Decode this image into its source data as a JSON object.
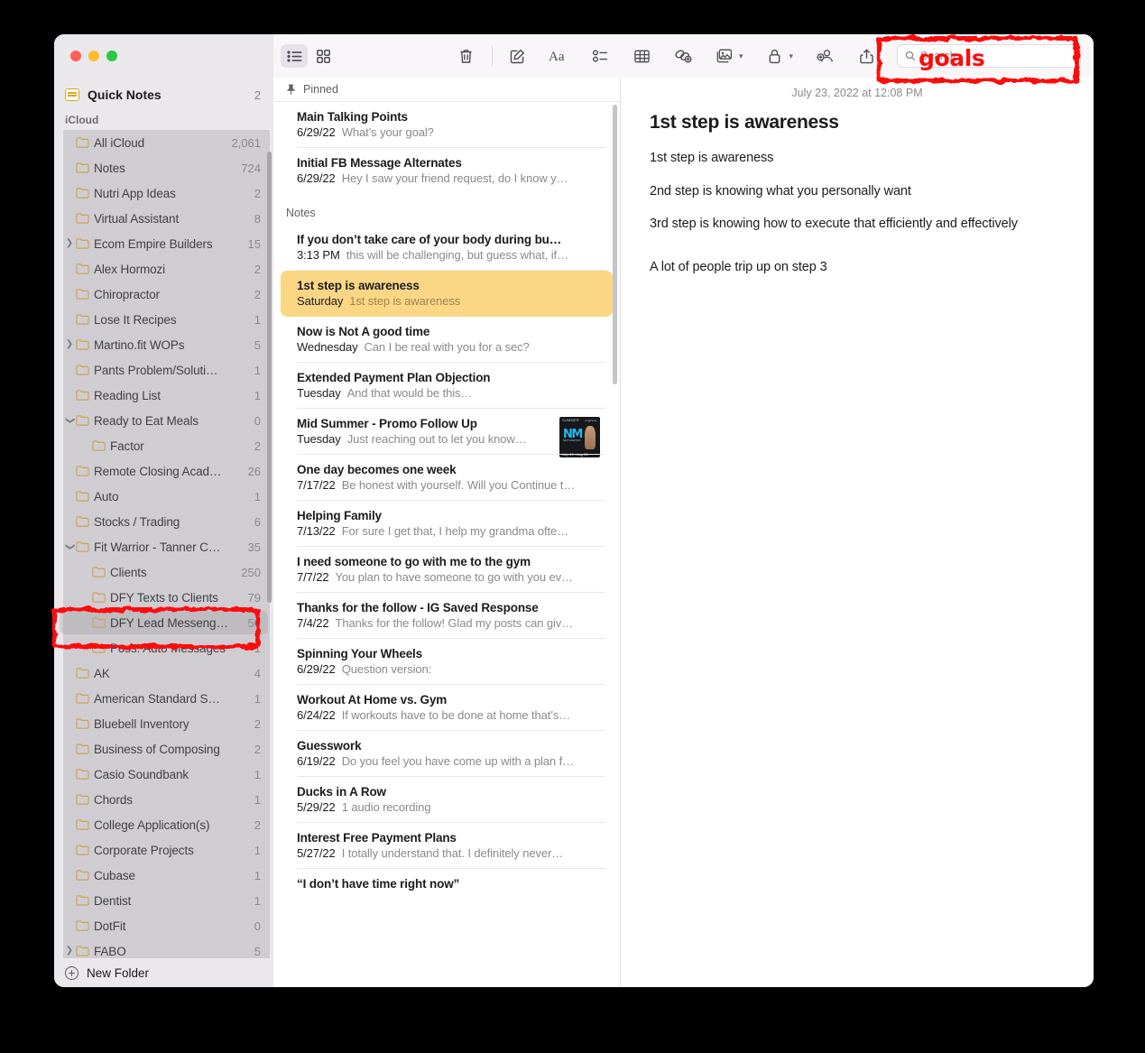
{
  "window": {
    "traffic_lights": [
      "close",
      "minimize",
      "zoom"
    ]
  },
  "sidebar": {
    "quick_notes": {
      "label": "Quick Notes",
      "count": "2",
      "icon": "quick-note-icon"
    },
    "section_icloud": "iCloud",
    "new_folder_label": "New Folder",
    "items": [
      {
        "label": "All iCloud",
        "count": "2,061",
        "indent": 0,
        "disclosure": ""
      },
      {
        "label": "Notes",
        "count": "724",
        "indent": 0,
        "disclosure": ""
      },
      {
        "label": "Nutri App Ideas",
        "count": "2",
        "indent": 0,
        "disclosure": ""
      },
      {
        "label": "Virtual Assistant",
        "count": "8",
        "indent": 0,
        "disclosure": ""
      },
      {
        "label": "Ecom Empire Builders",
        "count": "15",
        "indent": 0,
        "disclosure": "collapsed"
      },
      {
        "label": "Alex Hormozi",
        "count": "2",
        "indent": 0,
        "disclosure": ""
      },
      {
        "label": "Chiropractor",
        "count": "2",
        "indent": 0,
        "disclosure": ""
      },
      {
        "label": "Lose It Recipes",
        "count": "1",
        "indent": 0,
        "disclosure": ""
      },
      {
        "label": "Martino.fit WOPs",
        "count": "5",
        "indent": 0,
        "disclosure": "collapsed"
      },
      {
        "label": "Pants Problem/Soluti…",
        "count": "1",
        "indent": 0,
        "disclosure": ""
      },
      {
        "label": "Reading List",
        "count": "1",
        "indent": 0,
        "disclosure": ""
      },
      {
        "label": "Ready to Eat Meals",
        "count": "0",
        "indent": 0,
        "disclosure": "expanded"
      },
      {
        "label": "Factor",
        "count": "2",
        "indent": 1,
        "disclosure": ""
      },
      {
        "label": "Remote Closing Acad…",
        "count": "26",
        "indent": 0,
        "disclosure": ""
      },
      {
        "label": "Auto",
        "count": "1",
        "indent": 0,
        "disclosure": ""
      },
      {
        "label": "Stocks / Trading",
        "count": "6",
        "indent": 0,
        "disclosure": ""
      },
      {
        "label": "Fit Warrior - Tanner C…",
        "count": "35",
        "indent": 0,
        "disclosure": "expanded"
      },
      {
        "label": "Clients",
        "count": "250",
        "indent": 1,
        "disclosure": ""
      },
      {
        "label": "DFY Texts to Clients",
        "count": "79",
        "indent": 1,
        "disclosure": ""
      },
      {
        "label": "DFY Lead Messeng…",
        "count": "50",
        "indent": 1,
        "disclosure": "",
        "selected": true
      },
      {
        "label": "Poss. Auto Messages",
        "count": "1",
        "indent": 1,
        "disclosure": ""
      },
      {
        "label": "AK",
        "count": "4",
        "indent": 0,
        "disclosure": ""
      },
      {
        "label": "American Standard S…",
        "count": "1",
        "indent": 0,
        "disclosure": ""
      },
      {
        "label": "Bluebell Inventory",
        "count": "2",
        "indent": 0,
        "disclosure": ""
      },
      {
        "label": "Business of Composing",
        "count": "2",
        "indent": 0,
        "disclosure": ""
      },
      {
        "label": "Casio Soundbank",
        "count": "1",
        "indent": 0,
        "disclosure": ""
      },
      {
        "label": "Chords",
        "count": "1",
        "indent": 0,
        "disclosure": ""
      },
      {
        "label": "College Application(s)",
        "count": "2",
        "indent": 0,
        "disclosure": ""
      },
      {
        "label": "Corporate Projects",
        "count": "1",
        "indent": 0,
        "disclosure": ""
      },
      {
        "label": "Cubase",
        "count": "1",
        "indent": 0,
        "disclosure": ""
      },
      {
        "label": "Dentist",
        "count": "1",
        "indent": 0,
        "disclosure": ""
      },
      {
        "label": "DotFit",
        "count": "0",
        "indent": 0,
        "disclosure": ""
      },
      {
        "label": "FABO",
        "count": "5",
        "indent": 0,
        "disclosure": "collapsed"
      }
    ]
  },
  "toolbar": {
    "buttons": [
      {
        "name": "list-view-icon",
        "active": true
      },
      {
        "name": "gallery-view-icon",
        "active": false
      },
      {
        "name": "trash-icon",
        "active": false
      },
      {
        "name": "compose-note-icon",
        "active": false
      },
      {
        "name": "format-text-icon",
        "active": false
      },
      {
        "name": "checklist-icon",
        "active": false
      },
      {
        "name": "table-icon",
        "active": false
      },
      {
        "name": "link-icon",
        "active": false
      },
      {
        "name": "media-icon",
        "active": false
      },
      {
        "name": "lock-icon",
        "active": false
      },
      {
        "name": "add-people-icon",
        "active": false
      },
      {
        "name": "share-icon",
        "active": false
      }
    ],
    "search": {
      "placeholder": "Search",
      "value": ""
    }
  },
  "note_list": {
    "pinned_label": "Pinned",
    "notes_label": "Notes",
    "pinned": [
      {
        "title": "Main Talking Points",
        "date": "6/29/22",
        "preview": "What’s your goal?"
      },
      {
        "title": "Initial FB Message Alternates",
        "date": "6/29/22",
        "preview": "Hey I saw your friend request, do I know y…"
      }
    ],
    "notes": [
      {
        "title": "If you don’t take care of your body during bu…",
        "date": "3:13 PM",
        "preview": "this will be challenging, but guess what, if…"
      },
      {
        "title": "1st step is awareness",
        "date": "Saturday",
        "preview": "1st step is awareness",
        "selected": true
      },
      {
        "title": "Now is Not A good time",
        "date": "Wednesday",
        "preview": "Can I be real with you for a sec?"
      },
      {
        "title": "Extended Payment Plan Objection",
        "date": "Tuesday",
        "preview": "And that would be this…"
      },
      {
        "title": "Mid Summer - Promo Follow Up",
        "date": "Tuesday",
        "preview": "Just reaching out to let you know…",
        "thumbnail": "promo-flyer-thumbnail"
      },
      {
        "title": "One day becomes one week",
        "date": "7/17/22",
        "preview": "Be honest with yourself. Will you Continue t…"
      },
      {
        "title": "Helping Family",
        "date": "7/13/22",
        "preview": "For sure I get that, I help my grandma ofte…"
      },
      {
        "title": "I need someone to go with me to the gym",
        "date": "7/7/22",
        "preview": "You plan to have someone to go with you ev…"
      },
      {
        "title": "Thanks for the follow - IG Saved Response",
        "date": "7/4/22",
        "preview": "Thanks for the follow! Glad my posts can giv…"
      },
      {
        "title": "Spinning Your Wheels",
        "date": "6/29/22",
        "preview": "Question version:"
      },
      {
        "title": "Workout At Home vs. Gym",
        "date": "6/24/22",
        "preview": "If workouts have to be done at home that’s…"
      },
      {
        "title": "Guesswork",
        "date": "6/19/22",
        "preview": "Do you feel you have come up with a plan f…"
      },
      {
        "title": "Ducks in A Row",
        "date": "5/29/22",
        "preview": "1 audio recording"
      },
      {
        "title": "Interest Free Payment Plans",
        "date": "5/27/22",
        "preview": "I totally understand that. I definitely never…"
      },
      {
        "title": "“I don’t have time right now”",
        "date": "",
        "preview": ""
      }
    ],
    "thumbnail_text": {
      "top_left": "SUMMER",
      "top_right": "programs",
      "logo": "NM",
      "sublogo": "NEXT MARTINO",
      "footer": "July 20 - Aug 20"
    }
  },
  "detail": {
    "date": "July 23, 2022 at 12:08 PM",
    "title": "1st step is awareness",
    "paragraphs": [
      "1st step is awareness",
      "2nd step is knowing what you personally want",
      "3rd step is knowing how to execute that efficiently and effectively",
      "A lot of people trip up on step 3"
    ]
  },
  "annotations": {
    "typed_text": "goals",
    "color": "#fb0d0d"
  }
}
